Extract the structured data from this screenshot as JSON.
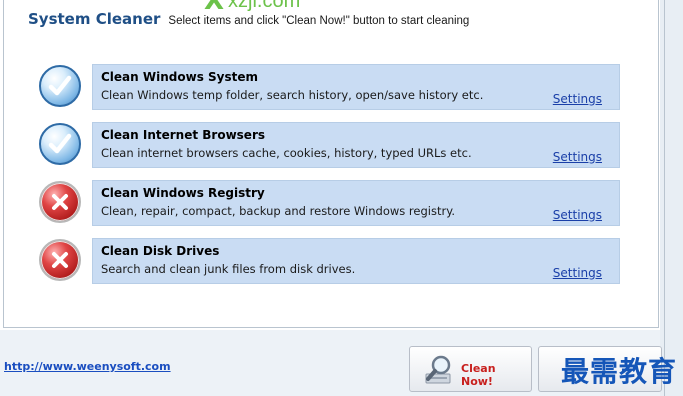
{
  "header": {
    "title": "System Cleaner",
    "subtitle": "Select items and click \"Clean Now!\" button to start cleaning"
  },
  "watermark_top": {
    "mark": "X",
    "text": "xzji.com"
  },
  "items": [
    {
      "title": "Clean Windows System",
      "description": "Clean Windows temp folder, search history, open/save history etc.",
      "link": "Settings",
      "status": "checked",
      "icon": "check-icon"
    },
    {
      "title": "Clean Internet Browsers",
      "description": "Clean internet browsers cache, cookies, history, typed URLs etc.",
      "link": "Settings",
      "status": "checked",
      "icon": "check-icon"
    },
    {
      "title": "Clean Windows Registry",
      "description": "Clean, repair, compact, backup and restore Windows registry.",
      "link": "Settings",
      "status": "unchecked",
      "icon": "x-icon"
    },
    {
      "title": "Clean Disk Drives",
      "description": "Search and clean junk files from disk drives.",
      "link": "Settings",
      "status": "unchecked",
      "icon": "x-icon"
    }
  ],
  "footer": {
    "link": "http://www.weenysoft.com",
    "clean_button": "Clean Now!",
    "watermark": "最需教育"
  },
  "colors": {
    "title": "#1f4f86",
    "row_background": "#c9dcf3",
    "link": "#1a3fa8",
    "clean_label": "#c8201e"
  }
}
